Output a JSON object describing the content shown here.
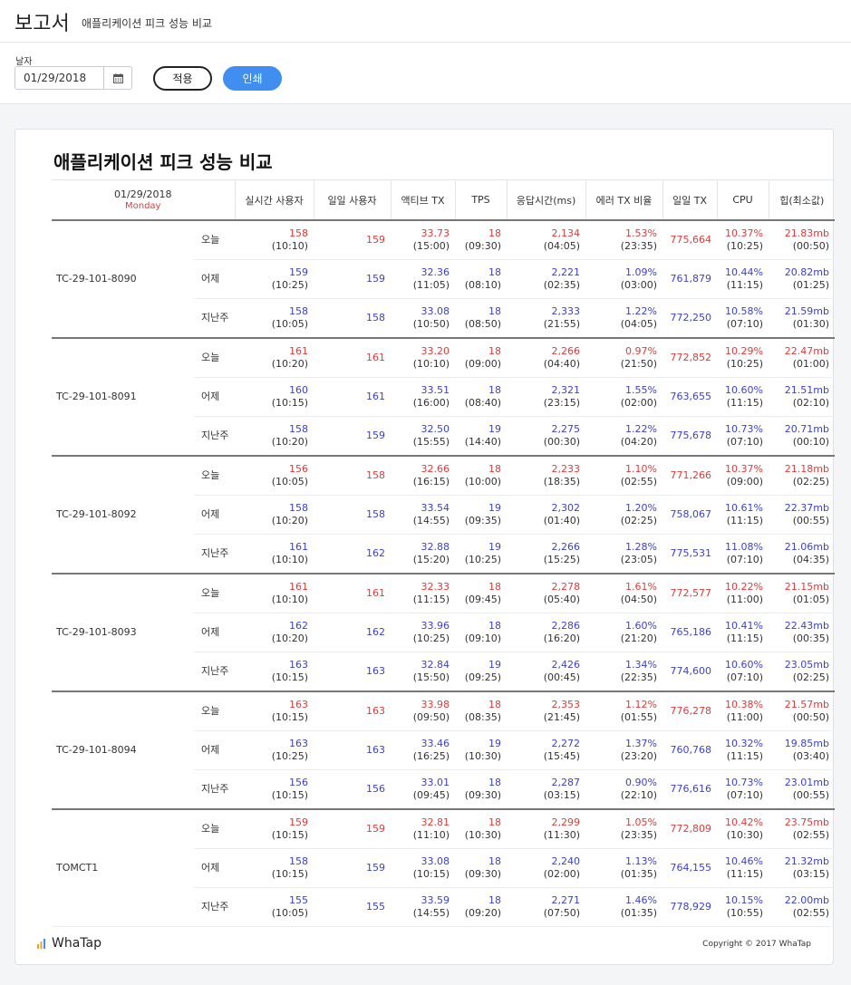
{
  "header": {
    "title": "보고서",
    "subtitle": "애플리케이션 피크 성능 비교"
  },
  "toolbar": {
    "date_label": "날자",
    "date_value": "01/29/2018",
    "apply_label": "적용",
    "print_label": "인쇄"
  },
  "report": {
    "title": "애플리케이션 피크 성능 비교",
    "date": "01/29/2018",
    "day": "Monday",
    "columns": [
      "실시간 사용자",
      "일일 사용자",
      "액티브 TX",
      "TPS",
      "응답시간(ms)",
      "에러 TX 비율",
      "일일 TX",
      "CPU",
      "힙(최소값)"
    ],
    "groups": [
      {
        "server": "TC-29-101-8090",
        "rows": [
          {
            "period": "오늘",
            "color": "red",
            "rt": "158",
            "rt_t": "(10:10)",
            "daily": "159",
            "atx": "33.73",
            "atx_t": "(15:00)",
            "tps": "18",
            "tps_t": "(09:30)",
            "resp": "2,134",
            "resp_t": "(04:05)",
            "err": "1.53%",
            "err_t": "(23:35)",
            "dtx": "775,664",
            "cpu": "10.37%",
            "cpu_t": "(10:25)",
            "heap": "21.83mb",
            "heap_t": "(00:50)"
          },
          {
            "period": "어제",
            "color": "blue",
            "rt": "159",
            "rt_t": "(10:25)",
            "daily": "159",
            "atx": "32.36",
            "atx_t": "(11:05)",
            "tps": "18",
            "tps_t": "(08:10)",
            "resp": "2,221",
            "resp_t": "(02:35)",
            "err": "1.09%",
            "err_t": "(03:00)",
            "dtx": "761,879",
            "cpu": "10.44%",
            "cpu_t": "(11:15)",
            "heap": "20.82mb",
            "heap_t": "(01:25)"
          },
          {
            "period": "지난주",
            "color": "blue",
            "rt": "158",
            "rt_t": "(10:05)",
            "daily": "158",
            "atx": "33.08",
            "atx_t": "(10:50)",
            "tps": "18",
            "tps_t": "(08:50)",
            "resp": "2,333",
            "resp_t": "(21:55)",
            "err": "1.22%",
            "err_t": "(04:05)",
            "dtx": "772,250",
            "cpu": "10.58%",
            "cpu_t": "(07:10)",
            "heap": "21.59mb",
            "heap_t": "(01:30)"
          }
        ]
      },
      {
        "server": "TC-29-101-8091",
        "rows": [
          {
            "period": "오늘",
            "color": "red",
            "rt": "161",
            "rt_t": "(10:20)",
            "daily": "161",
            "atx": "33.20",
            "atx_t": "(10:10)",
            "tps": "18",
            "tps_t": "(09:00)",
            "resp": "2,266",
            "resp_t": "(04:40)",
            "err": "0.97%",
            "err_t": "(21:50)",
            "dtx": "772,852",
            "cpu": "10.29%",
            "cpu_t": "(10:25)",
            "heap": "22.47mb",
            "heap_t": "(01:00)"
          },
          {
            "period": "어제",
            "color": "blue",
            "rt": "160",
            "rt_t": "(10:15)",
            "daily": "161",
            "atx": "33.51",
            "atx_t": "(16:00)",
            "tps": "18",
            "tps_t": "(08:40)",
            "resp": "2,321",
            "resp_t": "(23:15)",
            "err": "1.55%",
            "err_t": "(02:00)",
            "dtx": "763,655",
            "cpu": "10.60%",
            "cpu_t": "(11:15)",
            "heap": "21.51mb",
            "heap_t": "(02:10)"
          },
          {
            "period": "지난주",
            "color": "blue",
            "rt": "158",
            "rt_t": "(10:20)",
            "daily": "159",
            "atx": "32.50",
            "atx_t": "(15:55)",
            "tps": "19",
            "tps_t": "(14:40)",
            "resp": "2,275",
            "resp_t": "(00:30)",
            "err": "1.22%",
            "err_t": "(04:20)",
            "dtx": "775,678",
            "cpu": "10.73%",
            "cpu_t": "(07:10)",
            "heap": "20.71mb",
            "heap_t": "(00:10)"
          }
        ]
      },
      {
        "server": "TC-29-101-8092",
        "rows": [
          {
            "period": "오늘",
            "color": "red",
            "rt": "156",
            "rt_t": "(10:05)",
            "daily": "158",
            "atx": "32.66",
            "atx_t": "(16:15)",
            "tps": "18",
            "tps_t": "(10:00)",
            "resp": "2,233",
            "resp_t": "(18:35)",
            "err": "1.10%",
            "err_t": "(02:55)",
            "dtx": "771,266",
            "cpu": "10.37%",
            "cpu_t": "(09:00)",
            "heap": "21.18mb",
            "heap_t": "(02:25)"
          },
          {
            "period": "어제",
            "color": "blue",
            "rt": "158",
            "rt_t": "(10:20)",
            "daily": "158",
            "atx": "33.54",
            "atx_t": "(14:55)",
            "tps": "19",
            "tps_t": "(09:35)",
            "resp": "2,302",
            "resp_t": "(01:40)",
            "err": "1.20%",
            "err_t": "(02:25)",
            "dtx": "758,067",
            "cpu": "10.61%",
            "cpu_t": "(11:15)",
            "heap": "22.37mb",
            "heap_t": "(00:55)"
          },
          {
            "period": "지난주",
            "color": "blue",
            "rt": "161",
            "rt_t": "(10:10)",
            "daily": "162",
            "atx": "32.88",
            "atx_t": "(15:20)",
            "tps": "19",
            "tps_t": "(10:25)",
            "resp": "2,266",
            "resp_t": "(15:25)",
            "err": "1.28%",
            "err_t": "(23:05)",
            "dtx": "775,531",
            "cpu": "11.08%",
            "cpu_t": "(07:10)",
            "heap": "21.06mb",
            "heap_t": "(04:35)"
          }
        ]
      },
      {
        "server": "TC-29-101-8093",
        "rows": [
          {
            "period": "오늘",
            "color": "red",
            "rt": "161",
            "rt_t": "(10:10)",
            "daily": "161",
            "atx": "32.33",
            "atx_t": "(11:15)",
            "tps": "18",
            "tps_t": "(09:45)",
            "resp": "2,278",
            "resp_t": "(05:40)",
            "err": "1.61%",
            "err_t": "(04:50)",
            "dtx": "772,577",
            "cpu": "10.22%",
            "cpu_t": "(11:00)",
            "heap": "21.15mb",
            "heap_t": "(01:05)"
          },
          {
            "period": "어제",
            "color": "blue",
            "rt": "162",
            "rt_t": "(10:20)",
            "daily": "162",
            "atx": "33.96",
            "atx_t": "(10:25)",
            "tps": "18",
            "tps_t": "(09:10)",
            "resp": "2,286",
            "resp_t": "(16:20)",
            "err": "1.60%",
            "err_t": "(21:20)",
            "dtx": "765,186",
            "cpu": "10.41%",
            "cpu_t": "(11:15)",
            "heap": "22.43mb",
            "heap_t": "(00:35)"
          },
          {
            "period": "지난주",
            "color": "blue",
            "rt": "163",
            "rt_t": "(10:15)",
            "daily": "163",
            "atx": "32.84",
            "atx_t": "(15:50)",
            "tps": "19",
            "tps_t": "(09:25)",
            "resp": "2,426",
            "resp_t": "(00:45)",
            "err": "1.34%",
            "err_t": "(22:35)",
            "dtx": "774,600",
            "cpu": "10.60%",
            "cpu_t": "(07:10)",
            "heap": "23.05mb",
            "heap_t": "(02:25)"
          }
        ]
      },
      {
        "server": "TC-29-101-8094",
        "rows": [
          {
            "period": "오늘",
            "color": "red",
            "rt": "163",
            "rt_t": "(10:15)",
            "daily": "163",
            "atx": "33.98",
            "atx_t": "(09:50)",
            "tps": "18",
            "tps_t": "(08:35)",
            "resp": "2,353",
            "resp_t": "(21:45)",
            "err": "1.12%",
            "err_t": "(01:55)",
            "dtx": "776,278",
            "cpu": "10.38%",
            "cpu_t": "(11:00)",
            "heap": "21.57mb",
            "heap_t": "(00:50)"
          },
          {
            "period": "어제",
            "color": "blue",
            "rt": "163",
            "rt_t": "(10:25)",
            "daily": "163",
            "atx": "33.46",
            "atx_t": "(16:25)",
            "tps": "19",
            "tps_t": "(10:30)",
            "resp": "2,272",
            "resp_t": "(15:45)",
            "err": "1.37%",
            "err_t": "(23:20)",
            "dtx": "760,768",
            "cpu": "10.32%",
            "cpu_t": "(11:15)",
            "heap": "19.85mb",
            "heap_t": "(03:40)"
          },
          {
            "period": "지난주",
            "color": "blue",
            "rt": "156",
            "rt_t": "(10:15)",
            "daily": "156",
            "atx": "33.01",
            "atx_t": "(09:45)",
            "tps": "18",
            "tps_t": "(09:30)",
            "resp": "2,287",
            "resp_t": "(03:15)",
            "err": "0.90%",
            "err_t": "(22:10)",
            "dtx": "776,616",
            "cpu": "10.73%",
            "cpu_t": "(07:10)",
            "heap": "23.01mb",
            "heap_t": "(00:55)"
          }
        ]
      },
      {
        "server": "TOMCT1",
        "rows": [
          {
            "period": "오늘",
            "color": "red",
            "rt": "159",
            "rt_t": "(10:15)",
            "daily": "159",
            "atx": "32.81",
            "atx_t": "(11:10)",
            "tps": "18",
            "tps_t": "(10:30)",
            "resp": "2,299",
            "resp_t": "(11:30)",
            "err": "1.05%",
            "err_t": "(23:35)",
            "dtx": "772,809",
            "cpu": "10.42%",
            "cpu_t": "(10:30)",
            "heap": "23.75mb",
            "heap_t": "(02:55)"
          },
          {
            "period": "어제",
            "color": "blue",
            "rt": "158",
            "rt_t": "(10:15)",
            "daily": "159",
            "atx": "33.08",
            "atx_t": "(10:15)",
            "tps": "18",
            "tps_t": "(09:30)",
            "resp": "2,240",
            "resp_t": "(02:00)",
            "err": "1.13%",
            "err_t": "(01:35)",
            "dtx": "764,155",
            "cpu": "10.46%",
            "cpu_t": "(11:15)",
            "heap": "21.32mb",
            "heap_t": "(03:15)"
          },
          {
            "period": "지난주",
            "color": "blue",
            "rt": "155",
            "rt_t": "(10:05)",
            "daily": "155",
            "atx": "33.59",
            "atx_t": "(14:55)",
            "tps": "18",
            "tps_t": "(09:20)",
            "resp": "2,271",
            "resp_t": "(07:50)",
            "err": "1.46%",
            "err_t": "(01:35)",
            "dtx": "778,929",
            "cpu": "10.15%",
            "cpu_t": "(10:55)",
            "heap": "22.00mb",
            "heap_t": "(02:55)"
          }
        ]
      }
    ]
  },
  "footer": {
    "logo_text": "WhaTap",
    "copyright": "Copyright © 2017 WhaTap"
  },
  "colors": {
    "red": "#e03b3b",
    "blue": "#3b3fd6",
    "accent": "#3f8ef0"
  }
}
